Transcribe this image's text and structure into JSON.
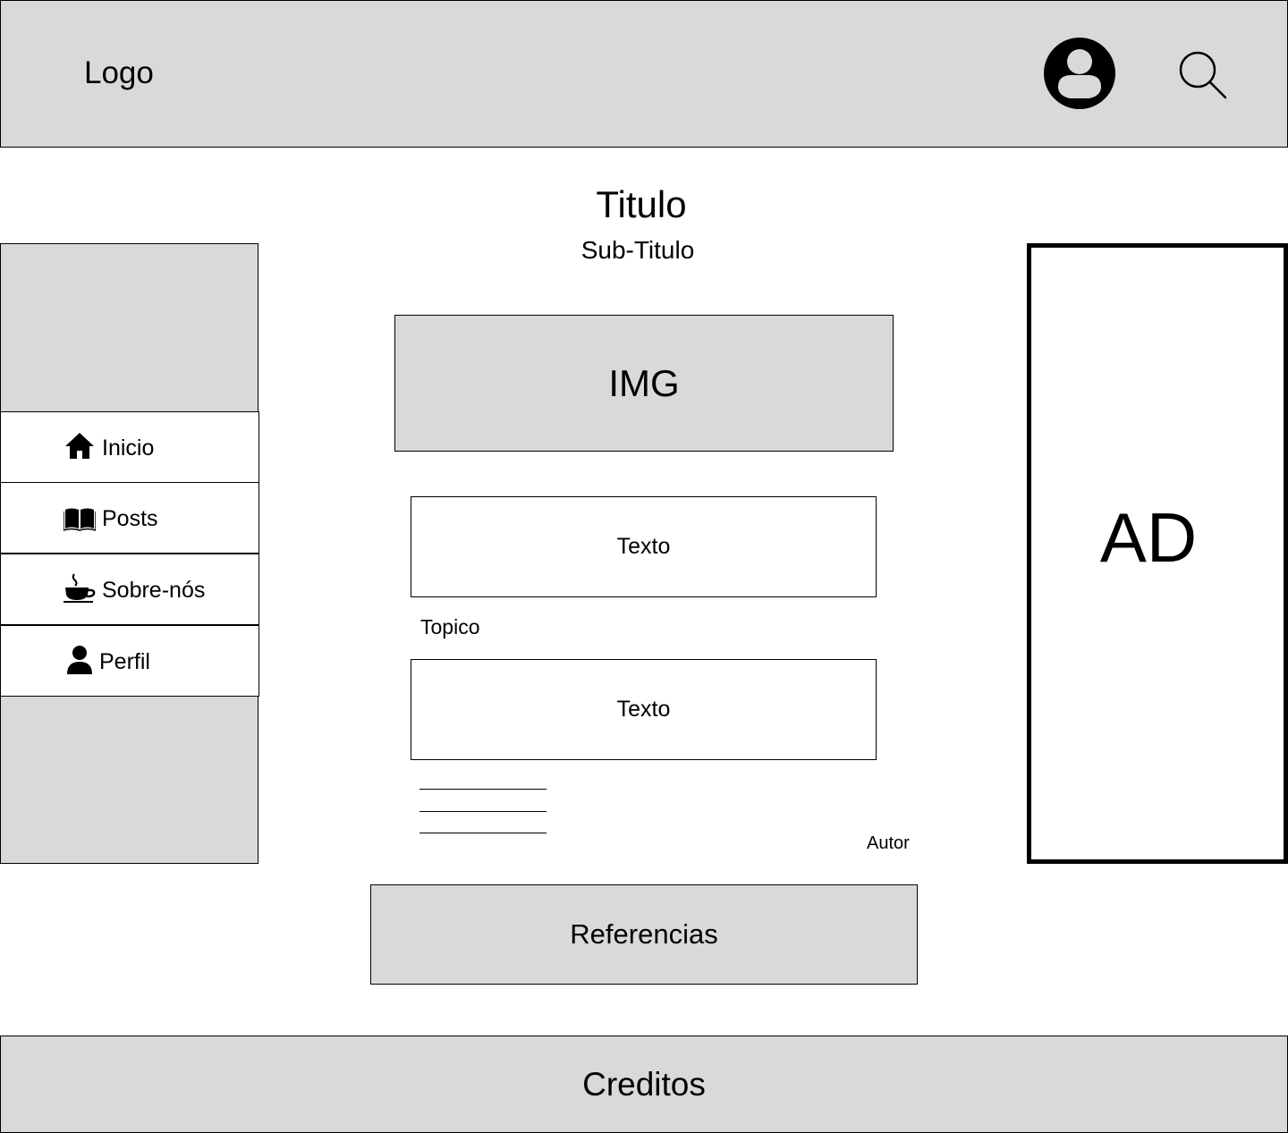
{
  "header": {
    "logo": "Logo",
    "icons": {
      "profile": "user-circle-icon",
      "search": "search-icon"
    }
  },
  "article": {
    "title": "Titulo",
    "subtitle": "Sub-Titulo",
    "image_label": "IMG",
    "text_blocks": [
      "Texto",
      "Texto"
    ],
    "topic": "Topico",
    "author": "Autor"
  },
  "sidebar": {
    "items": [
      {
        "label": "Inicio",
        "icon": "home-icon"
      },
      {
        "label": "Posts",
        "icon": "book-icon"
      },
      {
        "label": "Sobre-nós",
        "icon": "coffee-cup-icon"
      },
      {
        "label": "Perfil",
        "icon": "user-icon"
      }
    ]
  },
  "references": {
    "label": "Referencias"
  },
  "ad": {
    "label": "AD"
  },
  "footer": {
    "label": "Creditos"
  },
  "colors": {
    "panel_grey": "#d9d9d9",
    "stroke": "#000000",
    "background": "#ffffff"
  }
}
